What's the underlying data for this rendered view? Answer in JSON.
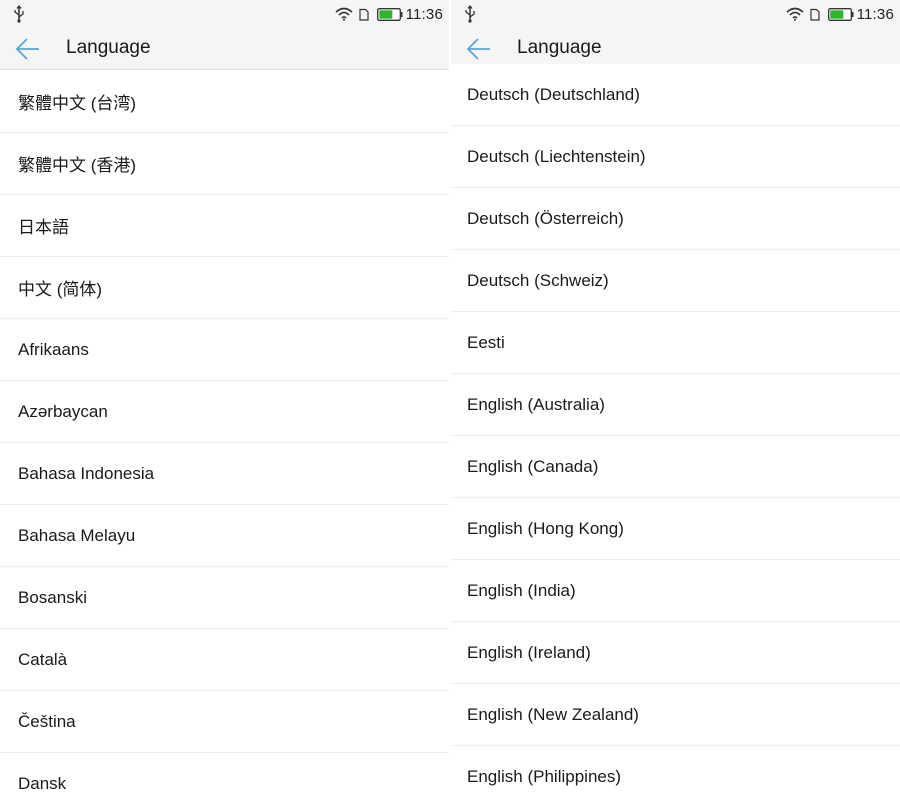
{
  "screens": [
    {
      "status": {
        "time": "11:36"
      },
      "title": "Language",
      "items": [
        "繁體中文 (台湾)",
        "繁體中文 (香港)",
        "日本語",
        "中文 (简体)",
        "Afrikaans",
        "Azərbaycan",
        "Bahasa Indonesia",
        "Bahasa Melayu",
        "Bosanski",
        "Català",
        "Čeština",
        "Dansk"
      ]
    },
    {
      "status": {
        "time": "11:36"
      },
      "title": "Language",
      "items": [
        "Deutsch (Deutschland)",
        "Deutsch (Liechtenstein)",
        "Deutsch (Österreich)",
        "Deutsch (Schweiz)",
        "Eesti",
        "English (Australia)",
        "English (Canada)",
        "English (Hong Kong)",
        "English (India)",
        "English (Ireland)",
        "English (New Zealand)",
        "English (Philippines)"
      ]
    }
  ],
  "icons": {
    "usb": "usb-icon",
    "wifi": "wifi-icon",
    "sim": "sim-icon",
    "battery": "battery-icon",
    "back": "back-arrow-icon"
  },
  "colors": {
    "accent": "#5aa6d6",
    "battery": "#2db52d",
    "bar_background": "#f5f5f7",
    "separator": "#ececec"
  }
}
